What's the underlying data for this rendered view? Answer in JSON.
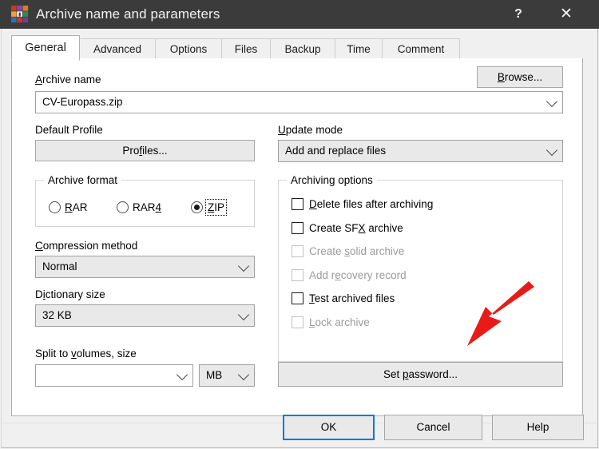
{
  "window": {
    "title": "Archive name and parameters",
    "icon": "winrar-books-icon",
    "help_label": "?",
    "close_label": "✕"
  },
  "tabs": [
    {
      "label": "General",
      "active": true
    },
    {
      "label": "Advanced",
      "active": false
    },
    {
      "label": "Options",
      "active": false
    },
    {
      "label": "Files",
      "active": false
    },
    {
      "label": "Backup",
      "active": false
    },
    {
      "label": "Time",
      "active": false
    },
    {
      "label": "Comment",
      "active": false
    }
  ],
  "archive_name": {
    "label_pre": "",
    "label_accel": "A",
    "label_post": "rchive name",
    "value": "CV-Europass.zip",
    "browse_pre": "",
    "browse_accel": "B",
    "browse_post": "rowse..."
  },
  "default_profile": {
    "label": "Default Profile",
    "button_pre": "Pro",
    "button_accel": "f",
    "button_post": "iles..."
  },
  "update_mode": {
    "label_pre": "",
    "label_accel": "U",
    "label_post": "pdate mode",
    "value": "Add and replace files"
  },
  "archive_format": {
    "title": "Archive format",
    "options": [
      {
        "pre": "",
        "accel": "R",
        "post": "AR",
        "selected": false,
        "focused": false
      },
      {
        "pre": "RAR",
        "accel": "4",
        "post": "",
        "selected": false,
        "focused": false
      },
      {
        "pre": "",
        "accel": "Z",
        "post": "IP",
        "selected": true,
        "focused": true
      }
    ]
  },
  "compression_method": {
    "label_pre": "",
    "label_accel": "C",
    "label_post": "ompression method",
    "value": "Normal"
  },
  "dictionary_size": {
    "label_pre": "D",
    "label_accel": "i",
    "label_post": "ctionary size",
    "value": "32 KB"
  },
  "split_to_volumes": {
    "label_pre": "Split to ",
    "label_accel": "v",
    "label_post": "olumes, size",
    "value": "",
    "unit_value": "MB"
  },
  "archiving_options": {
    "title": "Archiving options",
    "items": [
      {
        "pre": "",
        "accel": "D",
        "post": "elete files after archiving",
        "checked": false,
        "enabled": true
      },
      {
        "pre": "Create SF",
        "accel": "X",
        "post": " archive",
        "checked": false,
        "enabled": true
      },
      {
        "pre": "Create ",
        "accel": "s",
        "post": "olid archive",
        "checked": false,
        "enabled": false
      },
      {
        "pre": "Add r",
        "accel": "e",
        "post": "covery record",
        "checked": false,
        "enabled": false
      },
      {
        "pre": "",
        "accel": "T",
        "post": "est archived files",
        "checked": false,
        "enabled": true
      },
      {
        "pre": "",
        "accel": "L",
        "post": "ock archive",
        "checked": false,
        "enabled": false
      }
    ]
  },
  "set_password": {
    "pre": "Set ",
    "accel": "p",
    "post": "assword..."
  },
  "footer": {
    "ok_label": "OK",
    "cancel_label": "Cancel",
    "help_label": "Help"
  },
  "annotation": {
    "arrow_color": "#e81b19",
    "arrow_points_at": "set-password-button"
  },
  "colors": {
    "titlebar_bg": "#3b3b3b",
    "dialog_bg": "#f0f0f0",
    "page_bg": "#ffffff",
    "accent_default_button": "#0078d7",
    "disabled_text": "#9b9b9b"
  }
}
